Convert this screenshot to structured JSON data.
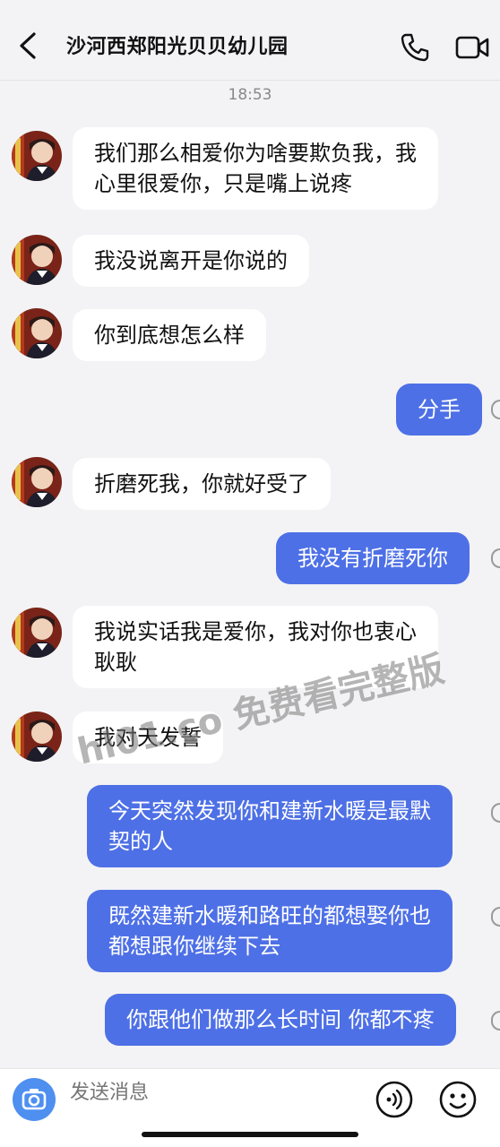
{
  "header": {
    "title": "沙河西郑阳光贝贝幼儿园",
    "back_icon": "chevron-left-icon",
    "call_icon": "phone-icon",
    "video_icon": "video-camera-icon"
  },
  "timestamp": "18:53",
  "messages": [
    {
      "side": "in",
      "lines": [
        "我们那么相爱你为啥要欺负我，我",
        "心里很爱你，只是嘴上说疼"
      ]
    },
    {
      "side": "in",
      "lines": [
        "我没说离开是你说的"
      ]
    },
    {
      "side": "in",
      "lines": [
        "你到底想怎么样"
      ]
    },
    {
      "side": "out",
      "lines": [
        "分手"
      ]
    },
    {
      "side": "in",
      "lines": [
        "折磨死我，你就好受了"
      ]
    },
    {
      "side": "out",
      "lines": [
        "我没有折磨死你"
      ]
    },
    {
      "side": "in",
      "lines": [
        "我说实话我是爱你，我对你也衷心",
        "耿耿"
      ]
    },
    {
      "side": "in",
      "lines": [
        "我对天发誓"
      ]
    },
    {
      "side": "out",
      "lines": [
        "今天突然发现你和建新水暖是最默",
        "契的人"
      ]
    },
    {
      "side": "out",
      "lines": [
        "既然建新水暖和路旺的都想娶你也",
        "都想跟你继续下去"
      ]
    },
    {
      "side": "out",
      "lines": [
        "你跟他们做那么长时间 你都不疼"
      ]
    }
  ],
  "watermark": "hl01.co 免费看完整版",
  "composer": {
    "placeholder": "发送消息",
    "camera_icon": "camera-icon",
    "voice_icon": "voice-icon",
    "emoji_icon": "emoji-icon"
  },
  "colors": {
    "outgoing_bubble": "#4e70e6",
    "incoming_bubble": "#ffffff",
    "background": "#f3f3f5",
    "camera_button": "#4e8ff0"
  }
}
